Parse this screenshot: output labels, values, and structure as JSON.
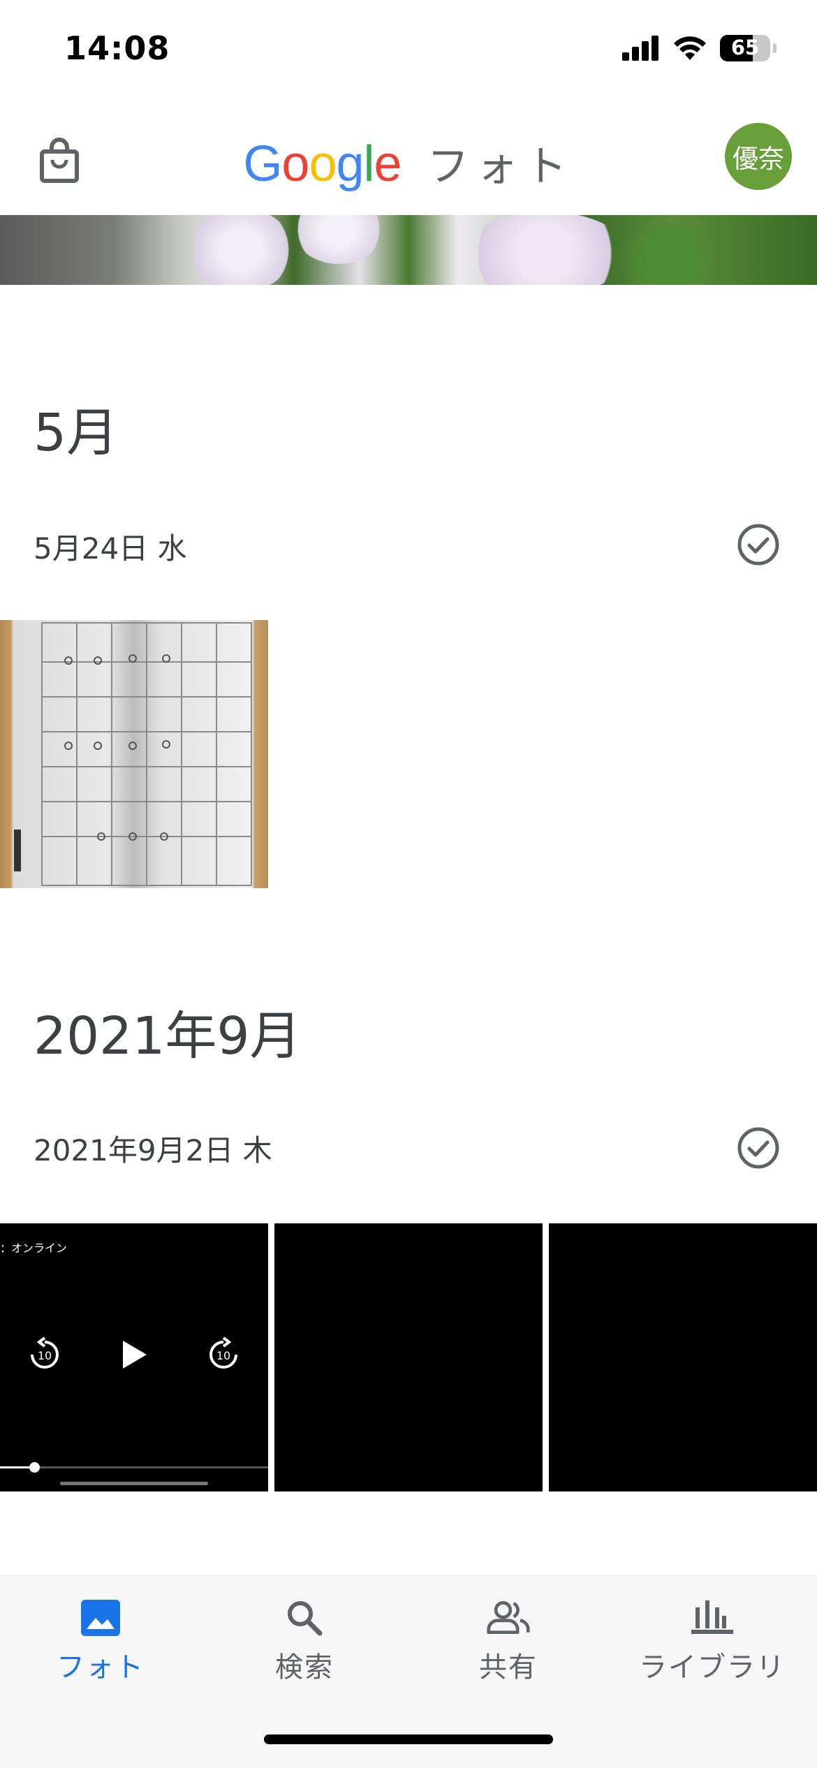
{
  "status_bar": {
    "time": "14:08",
    "battery": "65",
    "icons": [
      "signal-icon",
      "wifi-icon",
      "battery-icon"
    ]
  },
  "header": {
    "logo_google": [
      "G",
      "o",
      "o",
      "g",
      "l",
      "e"
    ],
    "logo_colors": [
      "#4285F4",
      "#EA4335",
      "#FBBC05",
      "#4285F4",
      "#34A853",
      "#EA4335"
    ],
    "logo_suffix": "フォト",
    "avatar_text": "優奈",
    "avatar_color": "#689f38",
    "icons": [
      "shopping-bag-icon"
    ]
  },
  "sections": [
    {
      "month": "5月",
      "date": "5月24日 水"
    },
    {
      "month": "2021年9月",
      "date": "2021年9月2日 木",
      "video_caption": "：オンライン"
    }
  ],
  "bottom_nav": {
    "active_color": "#1a73e8",
    "items": [
      {
        "label": "フォト",
        "icon": "photo-icon",
        "active": true
      },
      {
        "label": "検索",
        "icon": "search-icon",
        "active": false
      },
      {
        "label": "共有",
        "icon": "people-icon",
        "active": false
      },
      {
        "label": "ライブラリ",
        "icon": "library-icon",
        "active": false
      }
    ]
  }
}
